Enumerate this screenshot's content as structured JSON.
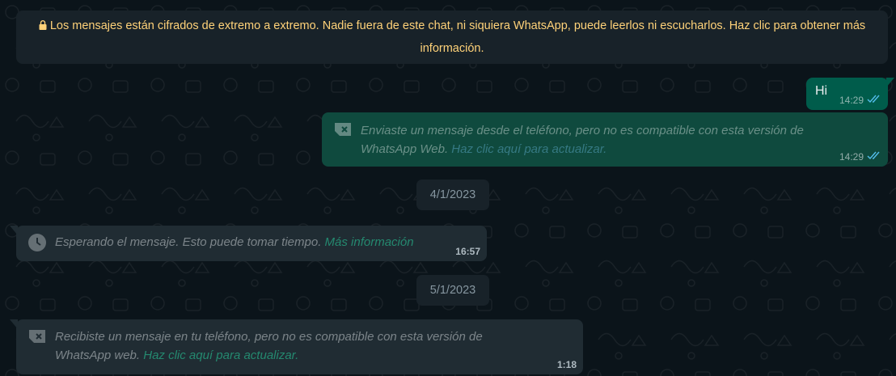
{
  "encryption_banner": {
    "text": "Los mensajes están cifrados de extremo a extremo. Nadie fuera de este chat, ni siquiera WhatsApp, puede leerlos ni escucharlos. Haz clic para obtener más información.",
    "icon": "lock-icon",
    "color": "#ffd279"
  },
  "messages": [
    {
      "direction": "outgoing",
      "text": "Hi",
      "time": "14:29",
      "status_icon": "double-check-icon"
    },
    {
      "direction": "outgoing",
      "icon": "unsupported-message-icon",
      "text": "Enviaste un mensaje desde el teléfono, pero no es compatible con esta versión de",
      "text_line2": "WhatsApp Web.",
      "link": "Haz clic aquí para actualizar.",
      "time": "14:29",
      "status_icon": "double-check-icon"
    },
    {
      "direction": "incoming",
      "icon": "clock-icon",
      "text": "Esperando el mensaje. Esto puede tomar tiempo.",
      "link": "Más información",
      "time": "16:57"
    },
    {
      "direction": "incoming",
      "icon": "unsupported-message-icon",
      "text": "Recibiste un mensaje en tu teléfono, pero no es compatible con esta versión de",
      "text_line2": "WhatsApp web.",
      "link": "Haz clic aquí para actualizar.",
      "time": "1:18"
    }
  ],
  "date_separators": [
    "4/1/2023",
    "5/1/2023"
  ],
  "colors": {
    "background": "#0b141a",
    "outgoing_bubble": "#005c4b",
    "incoming_bubble": "#202c33",
    "read_ticks": "#53bdeb",
    "link": "#26a884"
  }
}
